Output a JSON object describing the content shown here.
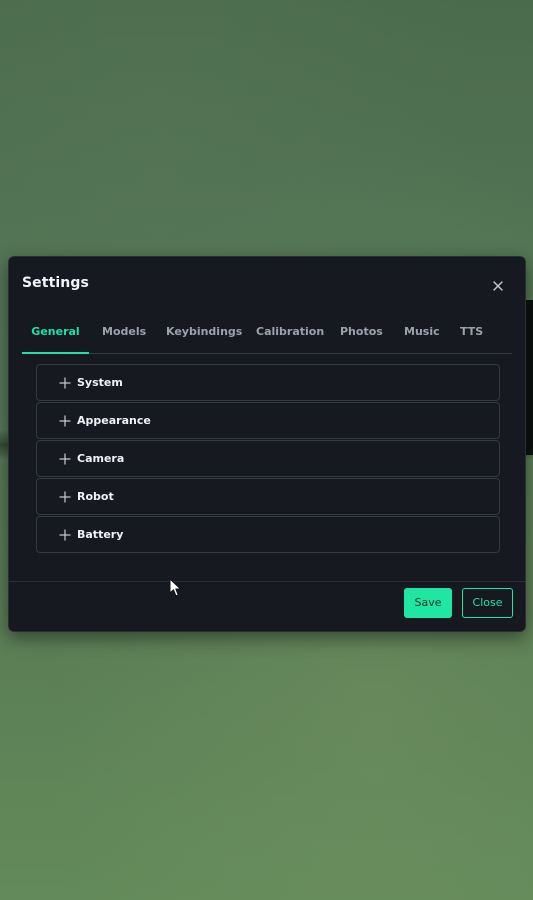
{
  "dialog": {
    "title": "Settings",
    "close_icon": "close-icon"
  },
  "tabs": [
    {
      "label": "General",
      "active": true
    },
    {
      "label": "Models",
      "active": false
    },
    {
      "label": "Keybindings",
      "active": false
    },
    {
      "label": "Calibration",
      "active": false
    },
    {
      "label": "Photos",
      "active": false
    },
    {
      "label": "Music",
      "active": false
    },
    {
      "label": "TTS",
      "active": false
    }
  ],
  "sections": [
    {
      "label": "System",
      "icon": "plus-icon",
      "expanded": false
    },
    {
      "label": "Appearance",
      "icon": "plus-icon",
      "expanded": false
    },
    {
      "label": "Camera",
      "icon": "plus-icon",
      "expanded": false
    },
    {
      "label": "Robot",
      "icon": "plus-icon",
      "expanded": false
    },
    {
      "label": "Battery",
      "icon": "plus-icon",
      "expanded": false
    }
  ],
  "footer": {
    "save_label": "Save",
    "close_label": "Close"
  },
  "colors": {
    "accent": "#1fe0a6",
    "dialog_bg": "#161a20",
    "border": "#343a44",
    "text_primary": "#f0f2f4",
    "text_muted": "#9aa3ad"
  },
  "pointer": {
    "icon": "mouse-pointer-icon"
  }
}
